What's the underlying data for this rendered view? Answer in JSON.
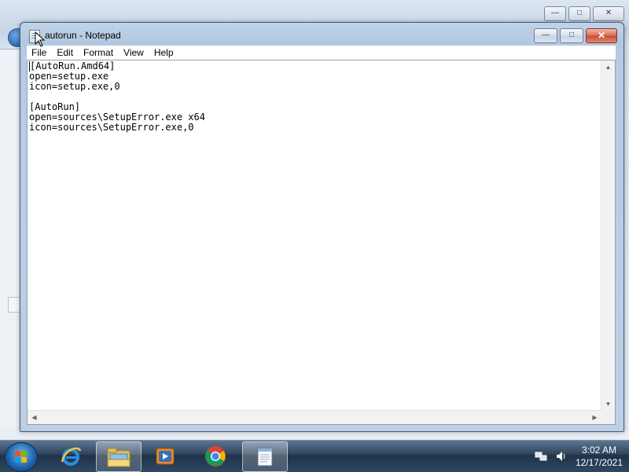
{
  "window": {
    "title": "autorun - Notepad",
    "controls": {
      "minimize": "—",
      "maximize": "□",
      "close": "✕"
    }
  },
  "menu": [
    "File",
    "Edit",
    "Format",
    "View",
    "Help"
  ],
  "editor": {
    "lines": [
      "[AutoRun.Amd64]",
      "open=setup.exe",
      "icon=setup.exe,0",
      "",
      "[AutoRun]",
      "open=sources\\SetupError.exe x64",
      "icon=sources\\SetupError.exe,0"
    ]
  },
  "scrollbar": {
    "up": "▲",
    "down": "▼",
    "left": "◀",
    "right": "▶"
  },
  "taskbar": {
    "apps": [
      {
        "name": "Internet Explorer",
        "icon": "ie-icon"
      },
      {
        "name": "Windows Explorer",
        "icon": "folder-icon"
      },
      {
        "name": "Windows Media Player",
        "icon": "media-player-icon"
      },
      {
        "name": "Google Chrome",
        "icon": "chrome-icon"
      },
      {
        "name": "Notepad",
        "icon": "notepad-icon"
      }
    ],
    "clock": {
      "time": "3:02 AM",
      "date": "12/17/2021"
    }
  },
  "colors": {
    "accent": "#1d5ea8",
    "close": "#c74a31"
  }
}
